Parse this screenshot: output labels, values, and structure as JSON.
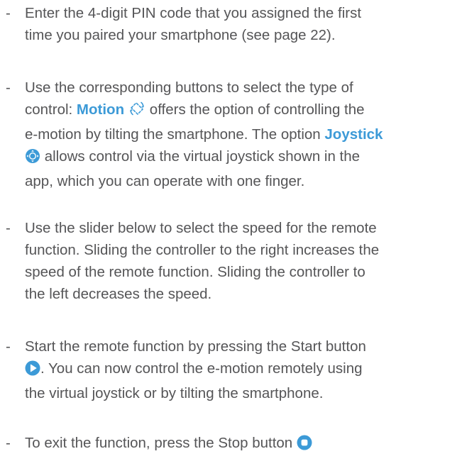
{
  "bullets": {
    "dash": "-",
    "item1": {
      "line1": "Enter the 4-digit PIN code that you assigned the first",
      "line2": "time you paired your smartphone (see page 22)."
    },
    "item2": {
      "line1": "Use the corresponding buttons to select the type of",
      "line2_pre": "control: ",
      "motion_label": "Motion",
      "line2_post": " offers the option of controlling the",
      "line3_pre": "e-motion by tilting the smartphone. The option ",
      "joystick_label": "Joystick",
      "line4": " allows control via the virtual joystick shown in the",
      "line5": "app, which you can operate with one finger."
    },
    "item3": {
      "line1": "Use the slider below to select the speed for the remote",
      "line2": "function. Sliding the controller to the right increases the",
      "line3": "speed of the remote function. Sliding the controller to",
      "line4": "the left decreases the speed."
    },
    "item4": {
      "line1": "Start the remote function by pressing the Start button",
      "line2": ". You can now control the e-motion remotely using",
      "line3": "the virtual joystick or by tilting the smartphone."
    },
    "item5": {
      "line1": "To exit the function, press the Stop button "
    }
  },
  "icons": {
    "motion": "motion-tilt-icon",
    "joystick": "joystick-icon",
    "start": "play-icon",
    "stop": "stop-icon"
  },
  "colors": {
    "text": "#555557",
    "accent": "#3c9ad7"
  }
}
